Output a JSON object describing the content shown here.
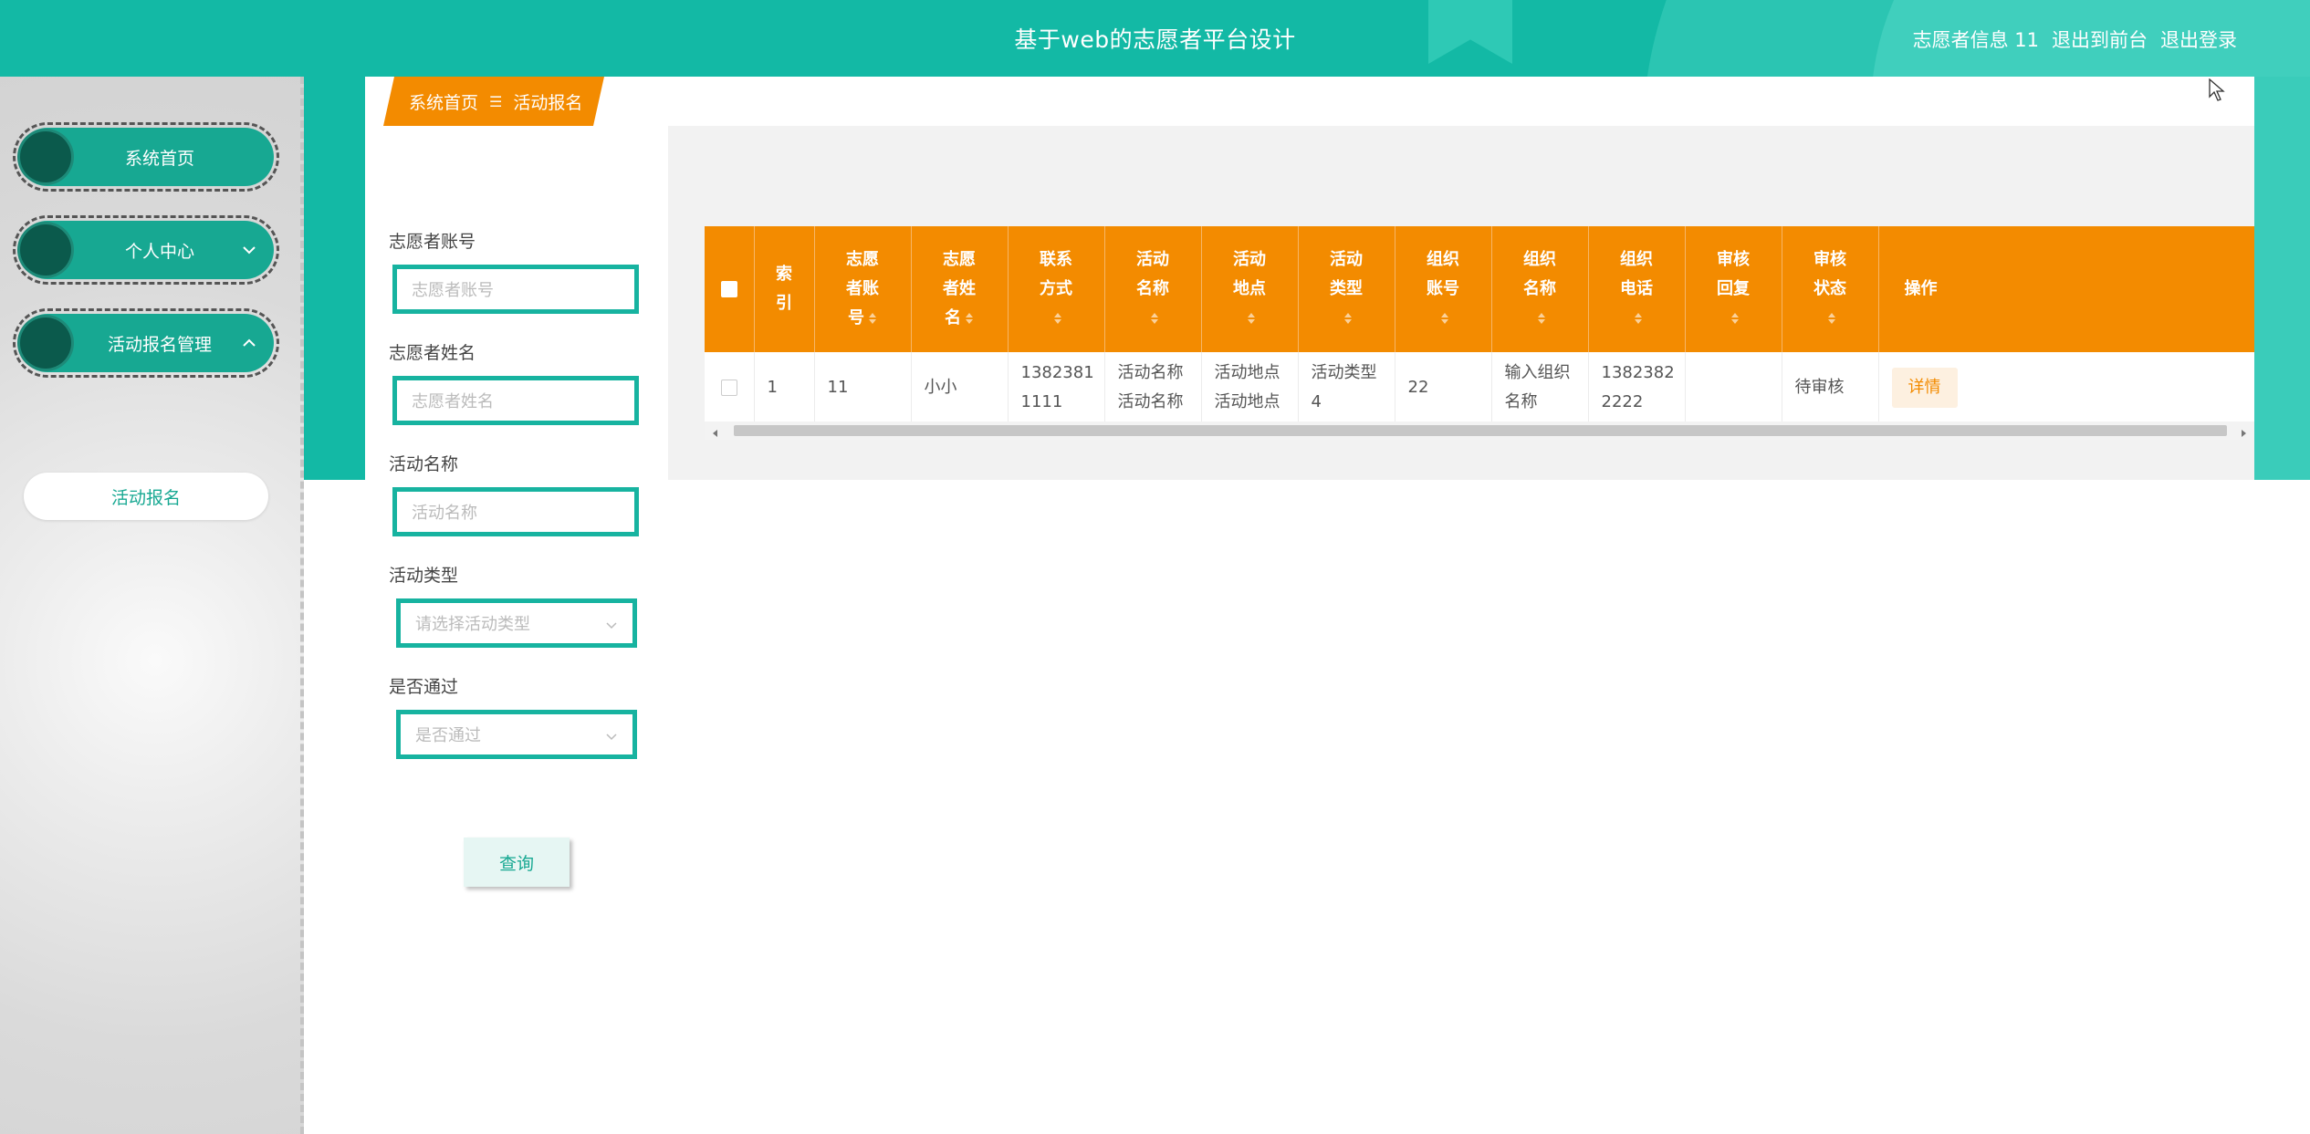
{
  "header": {
    "title": "基于web的志愿者平台设计",
    "user_info": "志愿者信息 11",
    "back_to_front": "退出到前台",
    "logout": "退出登录"
  },
  "sidebar": {
    "items": [
      {
        "label": "系统首页",
        "icon": "none"
      },
      {
        "label": "个人中心",
        "icon": "chevron-down-icon"
      },
      {
        "label": "活动报名管理",
        "icon": "chevron-up-icon"
      }
    ],
    "sub_items": [
      {
        "label": "活动报名"
      }
    ]
  },
  "breadcrumb": {
    "home": "系统首页",
    "separator": "☰",
    "current": "活动报名"
  },
  "filters": {
    "fields": [
      {
        "label": "志愿者账号",
        "placeholder": "志愿者账号",
        "type": "input"
      },
      {
        "label": "志愿者姓名",
        "placeholder": "志愿者姓名",
        "type": "input"
      },
      {
        "label": "活动名称",
        "placeholder": "活动名称",
        "type": "input"
      },
      {
        "label": "活动类型",
        "placeholder": "请选择活动类型",
        "type": "select"
      },
      {
        "label": "是否通过",
        "placeholder": "是否通过",
        "type": "select"
      }
    ],
    "query_button": "查询"
  },
  "table": {
    "columns": [
      {
        "l1": "索",
        "l2": "引",
        "l3": ""
      },
      {
        "l1": "志愿",
        "l2": "者账",
        "l3": "号"
      },
      {
        "l1": "志愿",
        "l2": "者姓",
        "l3": "名"
      },
      {
        "l1": "联系",
        "l2": "方式",
        "l3": ""
      },
      {
        "l1": "活动",
        "l2": "名称",
        "l3": ""
      },
      {
        "l1": "活动",
        "l2": "地点",
        "l3": ""
      },
      {
        "l1": "活动",
        "l2": "类型",
        "l3": ""
      },
      {
        "l1": "组织",
        "l2": "账号",
        "l3": ""
      },
      {
        "l1": "组织",
        "l2": "名称",
        "l3": ""
      },
      {
        "l1": "组织",
        "l2": "电话",
        "l3": ""
      },
      {
        "l1": "审核",
        "l2": "回复",
        "l3": ""
      },
      {
        "l1": "审核",
        "l2": "状态",
        "l3": ""
      },
      {
        "l1": "操作",
        "l2": "",
        "l3": ""
      }
    ],
    "rows": [
      {
        "index": "1",
        "volunteer_account": "11",
        "volunteer_name": "小小",
        "phone_1": "1382381",
        "phone_2": "1111",
        "activity_name_1": "活动名称",
        "activity_name_2": "活动名称",
        "location_1": "活动地点",
        "location_2": "活动地点",
        "type_1": "活动类型",
        "type_2": "4",
        "org_account": "22",
        "org_name_1": "输入组织",
        "org_name_2": "名称",
        "org_phone_1": "1382382",
        "org_phone_2": "2222",
        "reply": "",
        "status": "待审核",
        "action": "详情"
      }
    ]
  },
  "colors": {
    "teal": "#13b9a5",
    "orange": "#f38b00",
    "dark_teal": "#0b5a4c"
  }
}
